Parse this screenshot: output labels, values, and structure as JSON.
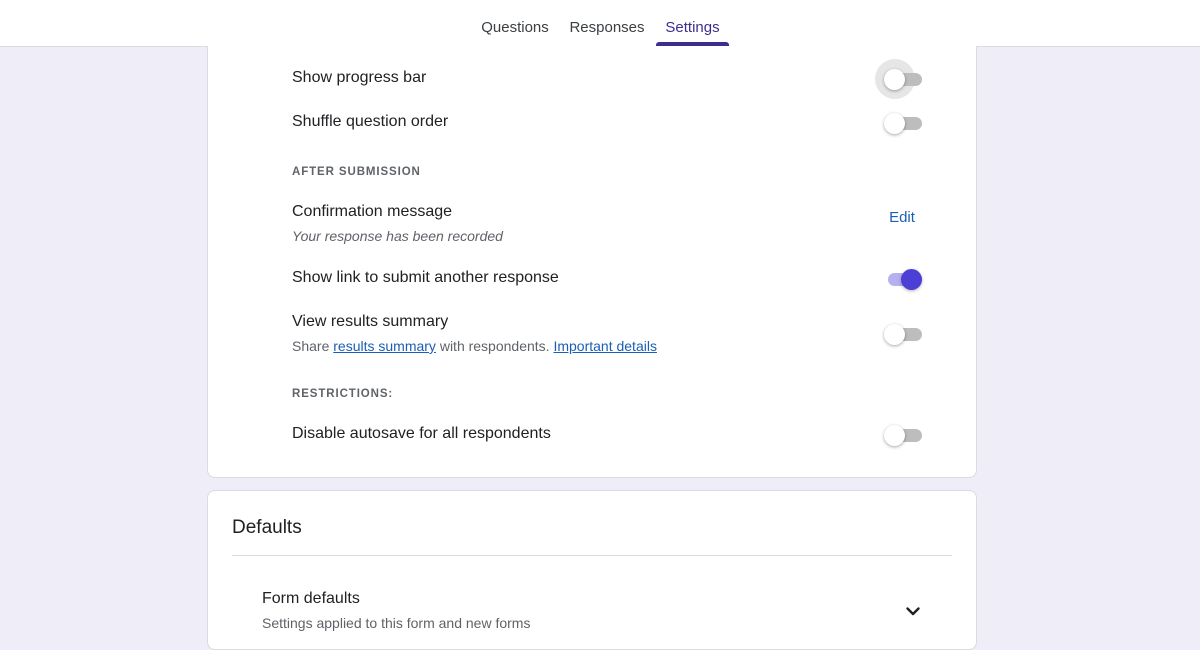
{
  "tabs": [
    {
      "label": "Questions",
      "active": false
    },
    {
      "label": "Responses",
      "active": false
    },
    {
      "label": "Settings",
      "active": true
    }
  ],
  "presentation": {
    "show_progress_bar": {
      "label": "Show progress bar",
      "on": false
    },
    "shuffle_question_order": {
      "label": "Shuffle question order",
      "on": false
    }
  },
  "after_submission": {
    "heading": "AFTER SUBMISSION",
    "confirmation": {
      "label": "Confirmation message",
      "value": "Your response has been recorded",
      "edit_label": "Edit"
    },
    "submit_another": {
      "label": "Show link to submit another response",
      "on": true
    },
    "results_summary": {
      "label": "View results summary",
      "desc_prefix": "Share ",
      "desc_link": "results summary",
      "desc_middle": " with respondents. ",
      "desc_link2": "Important details",
      "on": false
    }
  },
  "restrictions": {
    "heading": "RESTRICTIONS:",
    "disable_autosave": {
      "label": "Disable autosave for all respondents",
      "on": false
    }
  },
  "defaults": {
    "title": "Defaults",
    "form_defaults": {
      "label": "Form defaults",
      "description": "Settings applied to this form and new forms"
    }
  },
  "colors": {
    "accent": "#3c2e8f",
    "toggle_on": "#4b3fd6",
    "link": "#1a5fb4",
    "background": "#efedf8"
  }
}
